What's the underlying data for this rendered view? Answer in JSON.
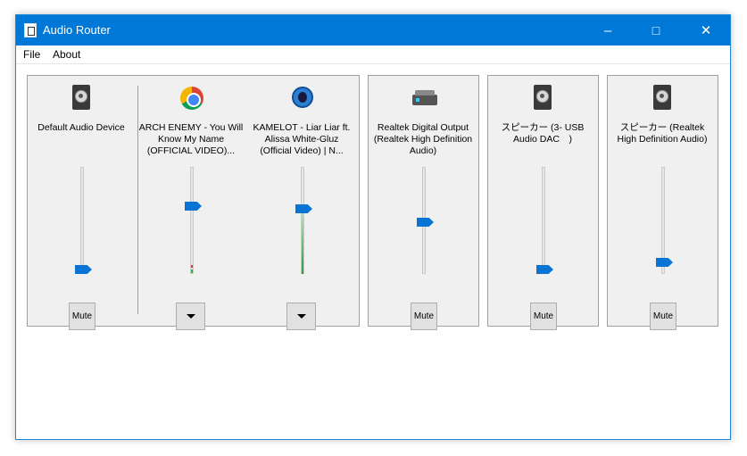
{
  "window": {
    "title": "Audio Router"
  },
  "menu": {
    "file": "File",
    "about": "About"
  },
  "title_buttons": {
    "minimize": "–",
    "maximize": "□",
    "close": "✕"
  },
  "devices": [
    {
      "label": "Default Audio Device",
      "icon": "speaker-icon",
      "volume": 0.1,
      "mute": "Mute",
      "streams": [
        {
          "label": "ARCH ENEMY - You Will Know My Name (OFFICIAL VIDEO)...",
          "icon": "chrome-icon",
          "volume": 0.65
        },
        {
          "label": "KAMELOT - Liar Liar ft. Alissa White-Gluz (Official Video) | N...",
          "icon": "waterfox-icon",
          "volume": 0.63
        }
      ]
    },
    {
      "label": "Realtek Digital Output (Realtek High Definition Audio)",
      "icon": "sound-card-icon",
      "volume": 0.5,
      "mute": "Mute"
    },
    {
      "label": "スピーカー (3- USB Audio DAC　)",
      "icon": "speaker-icon",
      "volume": 0.05,
      "mute": "Mute"
    },
    {
      "label": "スピーカー (Realtek High Definition Audio)",
      "icon": "speaker-icon",
      "volume": 0.12,
      "mute": "Mute"
    }
  ]
}
